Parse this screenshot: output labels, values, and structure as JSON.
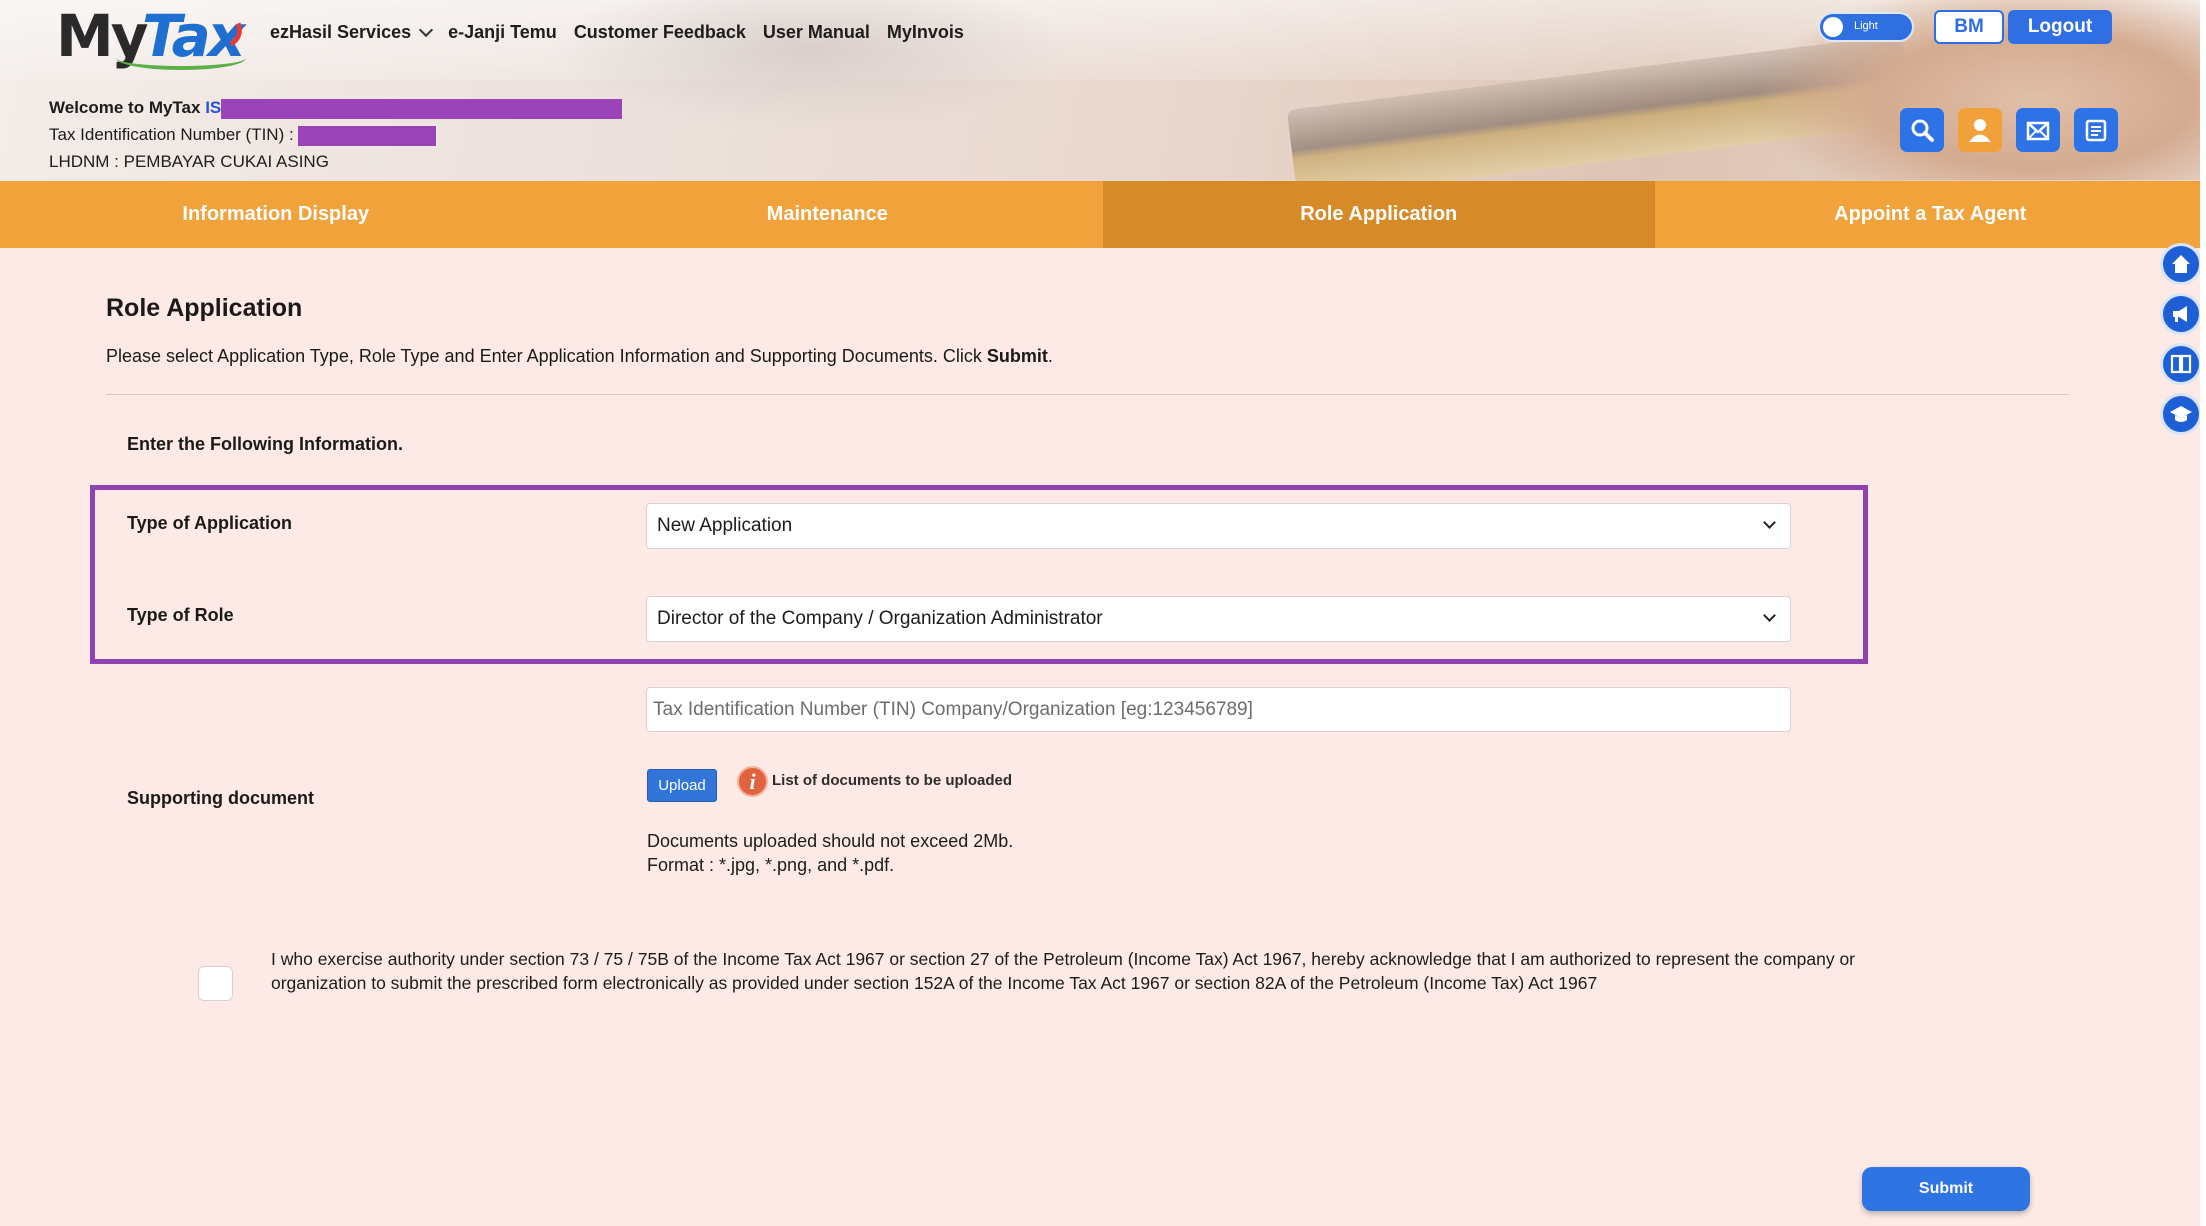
{
  "logo": {
    "part1": "My",
    "part2": "Tax"
  },
  "topnav": {
    "items": [
      {
        "label": "ezHasil Services",
        "has_dropdown": true
      },
      {
        "label": "e-Janji Temu"
      },
      {
        "label": "Customer Feedback"
      },
      {
        "label": "User Manual"
      },
      {
        "label": "MyInvois"
      }
    ]
  },
  "theme_toggle": {
    "label": "Light"
  },
  "header_buttons": {
    "language": "BM",
    "logout": "Logout"
  },
  "welcome": {
    "greeting": "Welcome to MyTax",
    "name_prefix": "IS",
    "tin_label": "Tax Identification Number (TIN) :",
    "lhdnm": "LHDNM : PEMBAYAR CUKAI ASING"
  },
  "header_icons": [
    "search-icon",
    "profile-icon",
    "mail-icon",
    "calendar-icon"
  ],
  "tabs": [
    {
      "label": "Information Display",
      "active": false
    },
    {
      "label": "Maintenance",
      "active": false
    },
    {
      "label": "Role Application",
      "active": true
    },
    {
      "label": "Appoint a Tax Agent",
      "active": false
    }
  ],
  "side_icons": [
    "home-icon",
    "announcement-icon",
    "book-icon",
    "graduation-icon"
  ],
  "page": {
    "title": "Role Application",
    "instruction": "Please select Application Type, Role Type and Enter Application Information and Supporting Documents. Click",
    "instruction_bold": "Submit",
    "instruction_end": ".",
    "enter_info": "Enter the Following Information."
  },
  "form": {
    "type_of_application": {
      "label": "Type of Application",
      "value": "New Application"
    },
    "type_of_role": {
      "label": "Type of Role",
      "value": "Director of the Company / Organization Administrator"
    },
    "tin_company": {
      "placeholder": "Tax Identification Number (TIN) Company/Organization [eg:123456789]"
    },
    "supporting_document": {
      "label": "Supporting document",
      "upload_label": "Upload",
      "doc_list_link": "List of documents to be uploaded",
      "note_line1": "Documents uploaded should not exceed 2Mb.",
      "note_line2": "Format : *.jpg, *.png, and *.pdf."
    },
    "declaration": "I who exercise authority under section 73 / 75 / 75B of the Income Tax Act 1967 or section 27 of the Petroleum (Income Tax) Act 1967, hereby acknowledge that I am authorized to represent the company or organization to submit the prescribed form electronically as provided under section 152A of the Income Tax Act 1967 or section 82A of the Petroleum (Income Tax) Act 1967",
    "submit_label": "Submit"
  },
  "colors": {
    "tab_bar": "#f2a23b",
    "tab_active": "#d68a28",
    "page_background": "#fdeae6",
    "primary_blue": "#2e74e3",
    "highlight_border": "#9043b0",
    "redaction": "#9a44b7"
  }
}
